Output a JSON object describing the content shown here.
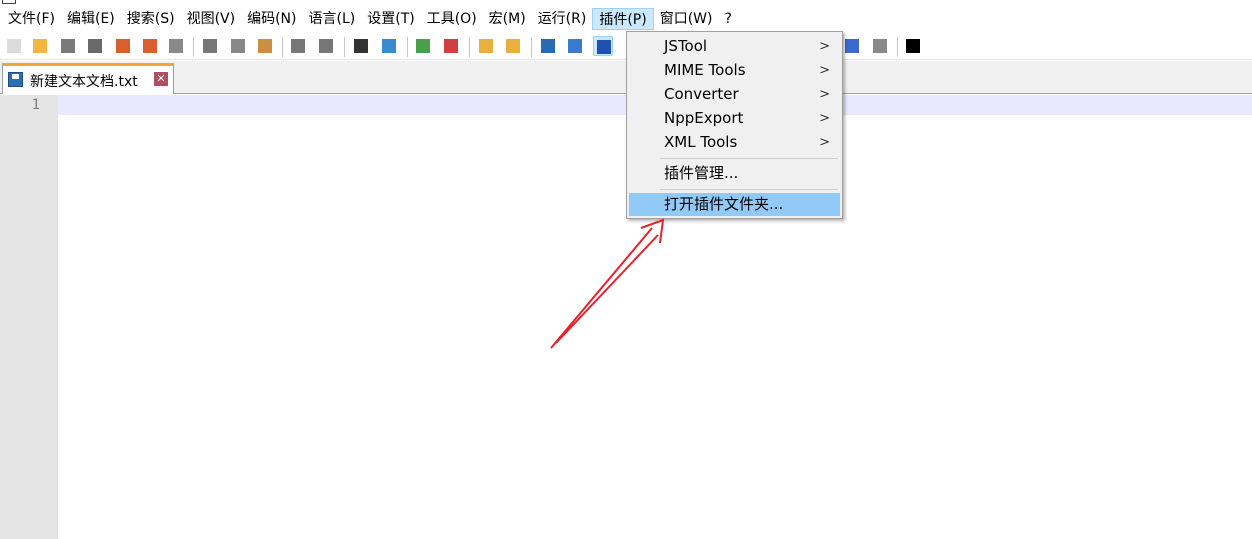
{
  "menubar": {
    "items": [
      "文件(F)",
      "编辑(E)",
      "搜索(S)",
      "视图(V)",
      "编码(N)",
      "语言(L)",
      "设置(T)",
      "工具(O)",
      "宏(M)",
      "运行(R)",
      "插件(P)",
      "窗口(W)",
      "?"
    ],
    "open_index": 10
  },
  "toolbar": {
    "icons": [
      "new-file",
      "open-file",
      "save",
      "save-all",
      "close",
      "close-all",
      "print",
      "cut",
      "copy",
      "paste",
      "undo",
      "redo",
      "find",
      "replace",
      "zoom-in",
      "zoom-out",
      "sync-vertical",
      "sync-horizontal",
      "word-wrap",
      "show-all-chars",
      "indent-guide",
      "run-macro-multiple",
      "save-macro",
      "jstool"
    ],
    "active": "indent-guide"
  },
  "tab": {
    "label": "新建文本文档.txt",
    "close": "✕"
  },
  "editor": {
    "line_numbers": [
      "1"
    ]
  },
  "plugins_menu": {
    "items": [
      {
        "label": "JSTool",
        "submenu": true
      },
      {
        "label": "MIME Tools",
        "submenu": true
      },
      {
        "label": "Converter",
        "submenu": true
      },
      {
        "label": "NppExport",
        "submenu": true
      },
      {
        "label": "XML Tools",
        "submenu": true
      },
      {
        "label": "插件管理...",
        "submenu": false
      },
      {
        "label": "打开插件文件夹...",
        "submenu": false,
        "highlighted": true
      }
    ],
    "submenu_arrow": ">"
  },
  "colors": {
    "tab_accent": "#f7a33a",
    "menu_highlight": "#91c9f7",
    "current_line": "#e8e8ff",
    "annotation_arrow": "#e8212b"
  }
}
